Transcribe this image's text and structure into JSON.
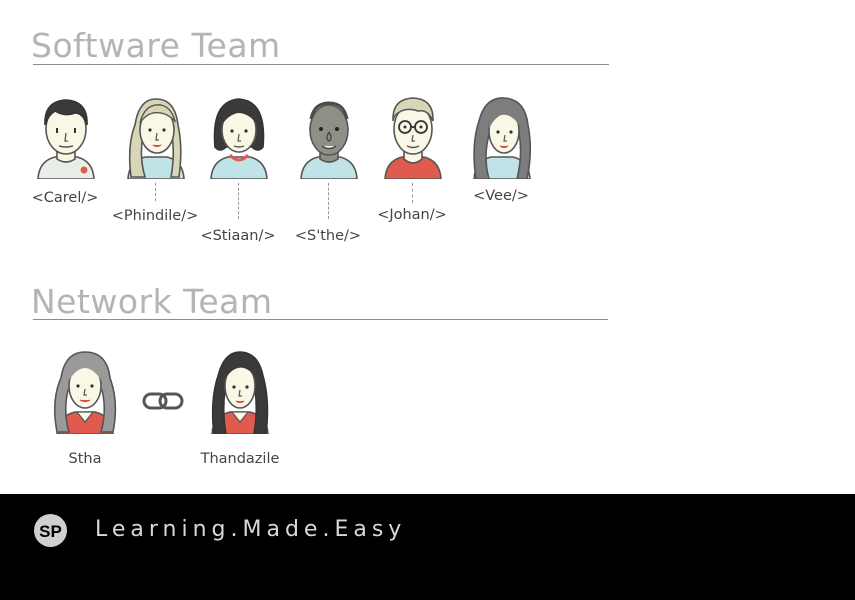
{
  "software_team": {
    "title": "Software Team",
    "members": [
      {
        "label": "<Carel/>",
        "avatar_icon": "man-short-dark-hair-avatar-icon",
        "shirt_color": "#e8efe6"
      },
      {
        "label": "<Phindile/>",
        "avatar_icon": "woman-long-blonde-hair-avatar-icon",
        "shirt_color": "#bfe3e6"
      },
      {
        "label": "<Stiaan/>",
        "avatar_icon": "person-dark-bob-hair-avatar-icon",
        "shirt_color": "#bfe3e6"
      },
      {
        "label": "<S'the/>",
        "avatar_icon": "bald-dark-skin-man-avatar-icon",
        "shirt_color": "#bfe3e6"
      },
      {
        "label": "<Johan/>",
        "avatar_icon": "man-glasses-avatar-icon",
        "shirt_color": "#e05a4e"
      },
      {
        "label": "<Vee/>",
        "avatar_icon": "woman-long-dark-hair-avatar-icon",
        "shirt_color": "#bfe3e6"
      }
    ]
  },
  "network_team": {
    "title": "Network Team",
    "members": [
      {
        "label": "Stha",
        "avatar_icon": "woman-long-curly-hair-avatar-icon"
      },
      {
        "label": "Thandazile",
        "avatar_icon": "woman-long-black-hair-avatar-icon"
      }
    ],
    "link_icon": "chain-link-icon"
  },
  "footer": {
    "logo_text": "SP",
    "tagline": "Learning.Made.Easy"
  },
  "colors": {
    "title_gray": "#b4b4b4",
    "footer_bg": "#000000",
    "skin_light": "#fbf7e6",
    "skin_dark": "#8f8f88",
    "accent_red": "#e05a4e",
    "shirt_blue": "#bfe3e6"
  }
}
